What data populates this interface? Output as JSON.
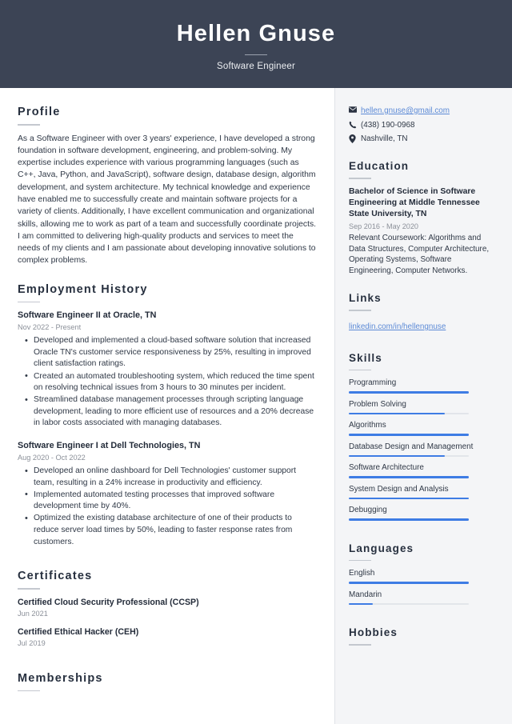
{
  "header": {
    "name": "Hellen Gnuse",
    "title": "Software Engineer"
  },
  "colors": {
    "header_bg": "#3c4455",
    "sidebar_bg": "#f4f5f7",
    "accent_bar": "#3e7ce4",
    "link": "#5c8ad6",
    "heading": "#27303f",
    "muted_text": "#8b9099"
  },
  "main": {
    "profile": {
      "heading": "Profile",
      "text": "As a Software Engineer with over 3 years' experience, I have developed a strong foundation in software development, engineering, and problem-solving. My expertise includes experience with various programming languages (such as C++, Java, Python, and JavaScript), software design, database design, algorithm development, and system architecture. My technical knowledge and experience have enabled me to successfully create and maintain software projects for a variety of clients. Additionally, I have excellent communication and organizational skills, allowing me to work as part of a team and successfully coordinate projects. I am committed to delivering high-quality products and services to meet the needs of my clients and I am passionate about developing innovative solutions to complex problems."
    },
    "employment": {
      "heading": "Employment History",
      "jobs": [
        {
          "title": "Software Engineer II at Oracle, TN",
          "date": "Nov 2022 - Present",
          "bullets": [
            "Developed and implemented a cloud-based software solution that increased Oracle TN's customer service responsiveness by 25%, resulting in improved client satisfaction ratings.",
            "Created an automated troubleshooting system, which reduced the time spent on resolving technical issues from 3 hours to 30 minutes per incident.",
            "Streamlined database management processes through scripting language development, leading to more efficient use of resources and a 20% decrease in labor costs associated with managing databases."
          ]
        },
        {
          "title": "Software Engineer I at Dell Technologies, TN",
          "date": "Aug 2020 - Oct 2022",
          "bullets": [
            "Developed an online dashboard for Dell Technologies' customer support team, resulting in a 24% increase in productivity and efficiency.",
            "Implemented automated testing processes that improved software development time by 40%.",
            "Optimized the existing database architecture of one of their products to reduce server load times by 50%, leading to faster response rates from customers."
          ]
        }
      ]
    },
    "certificates": {
      "heading": "Certificates",
      "items": [
        {
          "name": "Certified Cloud Security Professional (CCSP)",
          "date": "Jun 2021"
        },
        {
          "name": "Certified Ethical Hacker (CEH)",
          "date": "Jul 2019"
        }
      ]
    },
    "memberships": {
      "heading": "Memberships"
    }
  },
  "sidebar": {
    "contact": [
      {
        "icon": "envelope-icon",
        "value": "hellen.gnuse@gmail.com",
        "is_link": true
      },
      {
        "icon": "phone-icon",
        "value": "(438) 190-0968",
        "is_link": false
      },
      {
        "icon": "location-pin-icon",
        "value": "Nashville, TN",
        "is_link": false
      }
    ],
    "education": {
      "heading": "Education",
      "degree": "Bachelor of Science in Software Engineering at Middle Tennessee State University, TN",
      "date": "Sep 2016 - May 2020",
      "description": "Relevant Coursework: Algorithms and Data Structures, Computer Architecture, Operating Systems, Software Engineering, Computer Networks."
    },
    "links": {
      "heading": "Links",
      "items": [
        {
          "label": "linkedin.com/in/hellengnuse"
        }
      ]
    },
    "skills": {
      "heading": "Skills",
      "items": [
        {
          "label": "Programming",
          "level": 100
        },
        {
          "label": "Problem Solving",
          "level": 80
        },
        {
          "label": "Algorithms",
          "level": 100
        },
        {
          "label": "Database Design and Management",
          "level": 80
        },
        {
          "label": "Software Architecture",
          "level": 100
        },
        {
          "label": "System Design and Analysis",
          "level": 100
        },
        {
          "label": "Debugging",
          "level": 100
        }
      ]
    },
    "languages": {
      "heading": "Languages",
      "items": [
        {
          "label": "English",
          "level": 100
        },
        {
          "label": "Mandarin",
          "level": 20
        }
      ]
    },
    "hobbies": {
      "heading": "Hobbies"
    }
  }
}
